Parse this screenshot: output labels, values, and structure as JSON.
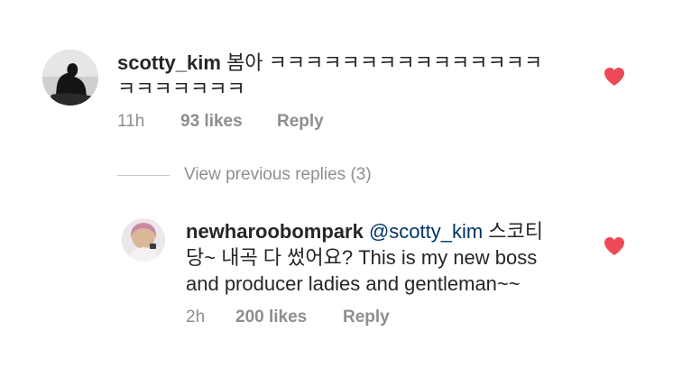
{
  "comments": [
    {
      "username": "scotty_kim",
      "text_line1": " 봄아 ㅋㅋㅋㅋㅋㅋㅋㅋㅋㅋㅋㅋㅋㅋㅋ",
      "text_line2": "ㅋㅋㅋㅋㅋㅋㅋ",
      "time": "11h",
      "likes": "93 likes",
      "reply_label": "Reply",
      "like_color": "#ed4956"
    }
  ],
  "view_previous_replies": "View previous replies (3)",
  "replies": [
    {
      "username": "newharoobompark",
      "mention": "@scotty_kim",
      "text_line1_tail": " 스코티",
      "text_line2": "당~ 내곡 다 썼어요? This is my new boss",
      "text_line3": "and producer ladies and gentleman~~",
      "time": "2h",
      "likes": "200 likes",
      "reply_label": "Reply",
      "like_color": "#ed4956"
    }
  ],
  "colors": {
    "text": "#262626",
    "muted": "#8e8e8e",
    "mention": "#003569",
    "heart": "#ed4956"
  },
  "icons": {
    "like": "heart-icon",
    "avatar_main": "avatar",
    "avatar_reply": "avatar"
  }
}
